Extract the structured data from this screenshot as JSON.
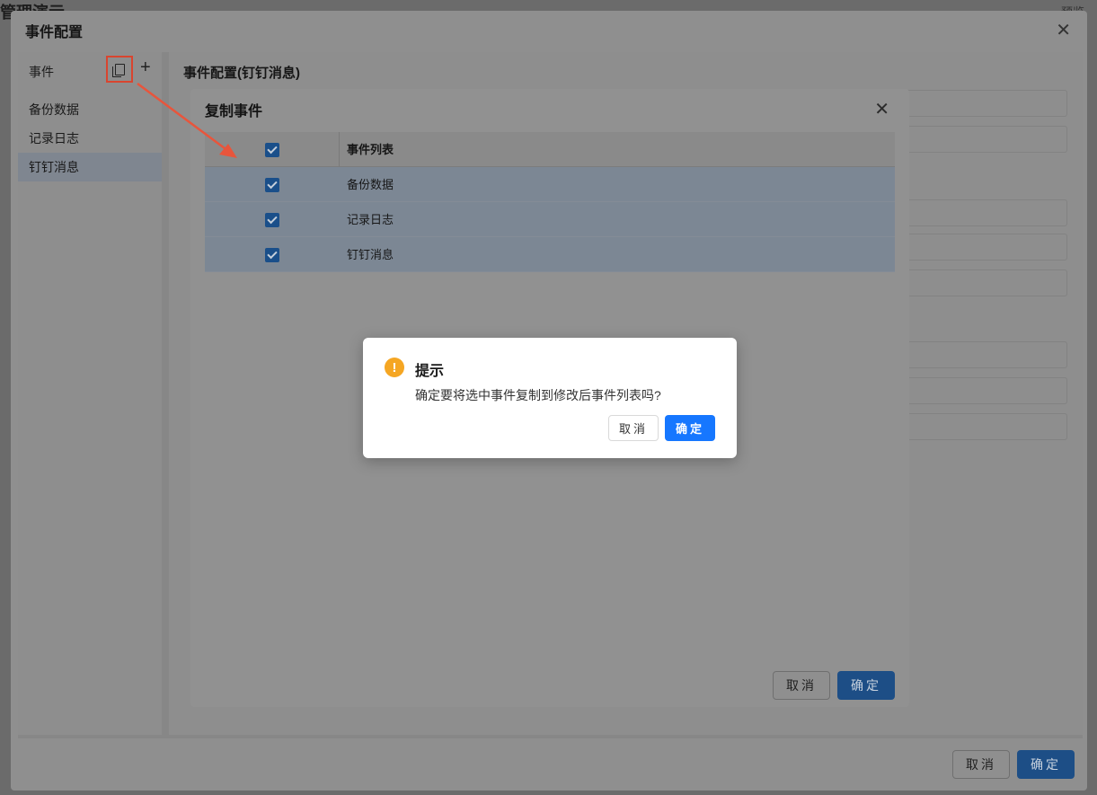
{
  "background_app": {
    "title": "管理演示",
    "preview_label": "预览"
  },
  "outer_dialog": {
    "title": "事件配置",
    "close_label": "✕",
    "left_header": "事件",
    "add_label": "+",
    "events": [
      "备份数据",
      "记录日志",
      "钉钉消息"
    ],
    "active_event_index": 2,
    "right_title": "事件配置(钉钉消息)",
    "cancel_label": "取消",
    "ok_label": "确定"
  },
  "copy_dialog": {
    "title": "复制事件",
    "close_label": "✕",
    "column_header": "事件列表",
    "rows": [
      {
        "label": "备份数据",
        "checked": true
      },
      {
        "label": "记录日志",
        "checked": true
      },
      {
        "label": "钉钉消息",
        "checked": true
      }
    ],
    "cancel_label": "取消",
    "ok_label": "确定"
  },
  "prompt": {
    "title": "提示",
    "icon": "warning-icon",
    "message": "确定要将选中事件复制到修改后事件列表吗?",
    "cancel_label": "取消",
    "ok_label": "确定"
  },
  "colors": {
    "primary": "#1677ff",
    "warning": "#f5a623",
    "highlight_box": "#d9452f"
  }
}
